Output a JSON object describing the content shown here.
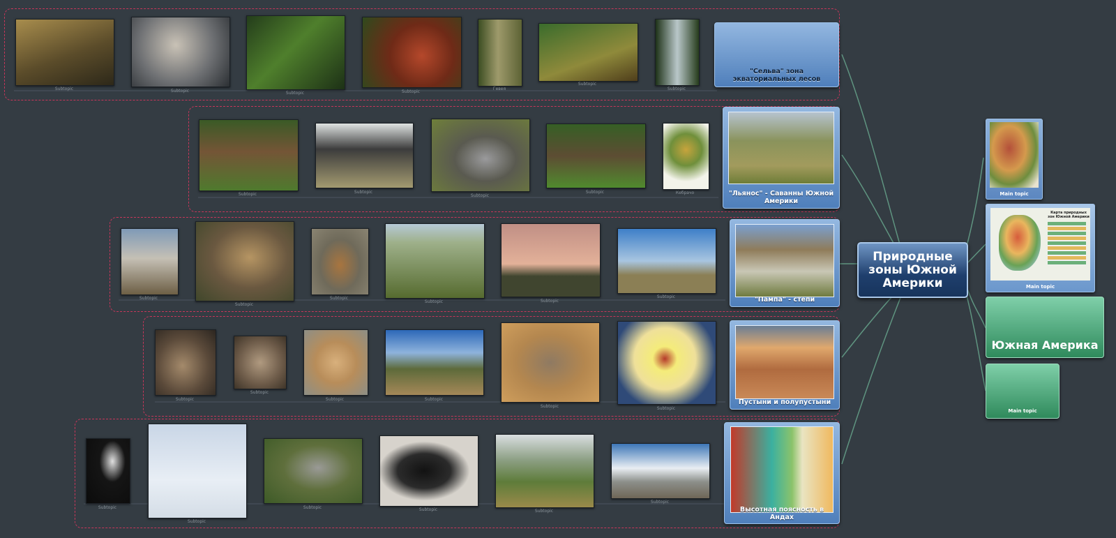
{
  "central_topic": "Природные зоны Южной Америки",
  "rows": [
    {
      "topic": "\"Сельва\" зона экваториальных лесов",
      "photos": [
        {
          "icon": "tapir-photo",
          "caption": "Subtopic"
        },
        {
          "icon": "piranha-photo",
          "caption": "Subtopic"
        },
        {
          "icon": "jungle-photo",
          "caption": "Subtopic"
        },
        {
          "icon": "cocoa-photo",
          "caption": "Subtopic"
        },
        {
          "icon": "rubber-tree-photo",
          "caption": "Гевея"
        },
        {
          "icon": "jaguar-photo",
          "caption": "Subtopic"
        },
        {
          "icon": "waterfall-photo",
          "caption": "Subtopic"
        }
      ]
    },
    {
      "topic": "\"Льянос\" - Саванны  Южной Америки",
      "photos": [
        {
          "icon": "peccary-photo",
          "caption": "Subtopic"
        },
        {
          "icon": "rhea-photo",
          "caption": "Subtopic"
        },
        {
          "icon": "armadillo-photo",
          "caption": "Subtopic"
        },
        {
          "icon": "anteater-photo",
          "caption": "Subtopic"
        },
        {
          "icon": "quebracho-illustration",
          "caption": "Кебрачо"
        }
      ]
    },
    {
      "topic": "\"Пампа\" - степи",
      "photos": [
        {
          "icon": "llama-photo",
          "caption": "Subtopic"
        },
        {
          "icon": "pampas-cat-photo",
          "caption": "Subtopic"
        },
        {
          "icon": "pampas-deer-photo",
          "caption": "Subtopic"
        },
        {
          "icon": "feather-grass-photo",
          "caption": "Subtopic"
        },
        {
          "icon": "savanna-tree-photo",
          "caption": "Subtopic"
        },
        {
          "icon": "cactus-landscape-photo",
          "caption": "Subtopic"
        }
      ]
    },
    {
      "topic": "Пустыни и полупустыни",
      "photos": [
        {
          "icon": "mara-photo",
          "caption": "Subtopic"
        },
        {
          "icon": "vizcacha-photo",
          "caption": "Subtopic"
        },
        {
          "icon": "wildcat-photo",
          "caption": "Subtopic"
        },
        {
          "icon": "cactus-desert-photo",
          "caption": "Subtopic"
        },
        {
          "icon": "snake-photo",
          "caption": "Subtopic"
        },
        {
          "icon": "cactus-flower-photo",
          "caption": "Subtopic"
        }
      ]
    },
    {
      "topic": "Высотная поясность в Андах",
      "photos": [
        {
          "icon": "condor-photo",
          "caption": "Subtopic"
        },
        {
          "icon": "flying-condor-photo",
          "caption": "Subtopic"
        },
        {
          "icon": "chinchilla-photo",
          "caption": "Subtopic"
        },
        {
          "icon": "spectacled-bear-photo",
          "caption": "Subtopic"
        },
        {
          "icon": "valley-landscape-photo",
          "caption": "Subtopic"
        },
        {
          "icon": "andes-mountain-photo",
          "caption": "Subtopic"
        }
      ]
    }
  ],
  "right_topics": [
    {
      "icon": "south-america-map",
      "label": "Main topic"
    },
    {
      "icon": "natural-zones-map",
      "label": "Main topic",
      "map_title": "Карта природных зон Южной Америки"
    },
    {
      "label": "Южная Америка"
    },
    {
      "label": "Main topic"
    }
  ],
  "colors": {
    "background": "#343c43",
    "boundary": "#c8365a",
    "topic_blue": "#6f95c4",
    "topic_green": "#3fa574",
    "link": "#5f9480"
  }
}
